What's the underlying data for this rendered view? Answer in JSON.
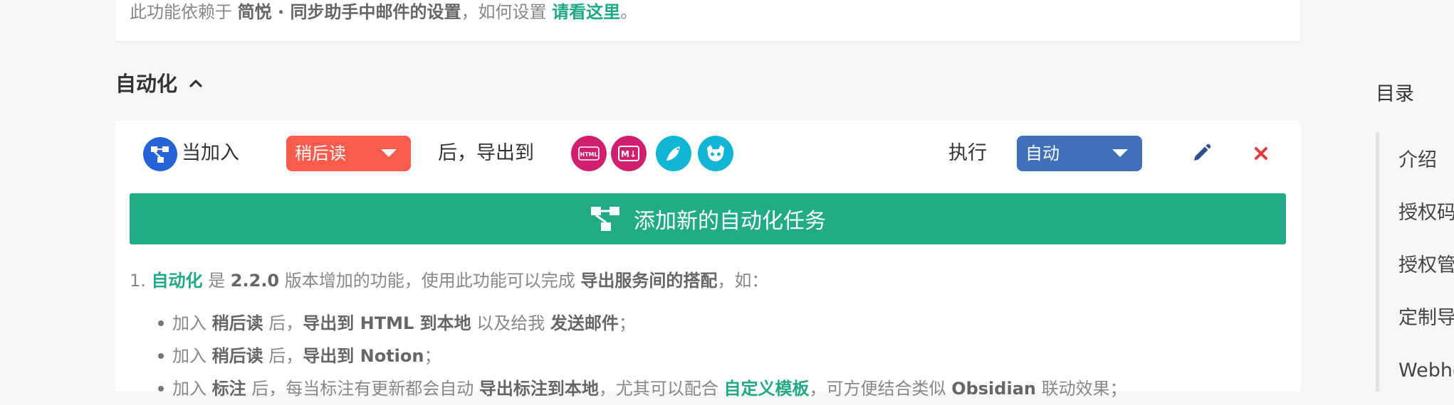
{
  "notice": {
    "prefix": "此功能依赖于 ",
    "bold": "简悦 · 同步助手中邮件的设置",
    "mid": "，如何设置 ",
    "link": "请看这里",
    "suffix": "。"
  },
  "section": {
    "title": "自动化"
  },
  "automation_row": {
    "when_label": "当加入",
    "trigger_select": "稍后读",
    "export_label": "后，导出到",
    "services": [
      {
        "name": "html-service-icon",
        "text": "HTML"
      },
      {
        "name": "markdown-service-icon",
        "text": "M↓"
      },
      {
        "name": "bird-service-icon",
        "text": ""
      },
      {
        "name": "github-service-icon",
        "text": ""
      }
    ],
    "exec_label": "执行",
    "exec_select": "自动"
  },
  "add_button": {
    "label": "添加新的自动化任务"
  },
  "description": {
    "num": "1. ",
    "green": "自动化",
    "t1": " 是 ",
    "version": "2.2.0",
    "t2": " 版本增加的功能，使用此功能可以完成 ",
    "bold": "导出服务间的搭配",
    "t3": "，如："
  },
  "bullets": [
    {
      "a": "加入 ",
      "b1": "稍后读",
      "c": " 后，",
      "b2": "导出到 HTML 到本地",
      "d": " 以及给我 ",
      "b3": "发送邮件",
      "e": "；"
    },
    {
      "a": "加入 ",
      "b1": "稍后读",
      "c": " 后，",
      "b2": "导出到 Notion",
      "d": "；"
    },
    {
      "a": "加入 ",
      "b1": "标注",
      "c": " 后，每当标注有更新都会自动 ",
      "b2": "导出标注到本地",
      "d": "，尤其可以配合 ",
      "g": "自定义模板",
      "e": "，可方便结合类似 ",
      "b3": "Obsidian",
      "f": " 联动效果；"
    }
  ],
  "toc": {
    "title": "目录",
    "items": [
      "介绍",
      "授权码",
      "授权管",
      "定制导",
      "Webho"
    ]
  },
  "colors": {
    "accent_green": "#22ab87",
    "select_red": "#f75c4c",
    "select_blue": "#3f70b8",
    "flow_blue": "#2563d9",
    "service_pink": "#d01f6e",
    "service_cyan": "#12b5d3",
    "close_red": "#e23b3b"
  }
}
